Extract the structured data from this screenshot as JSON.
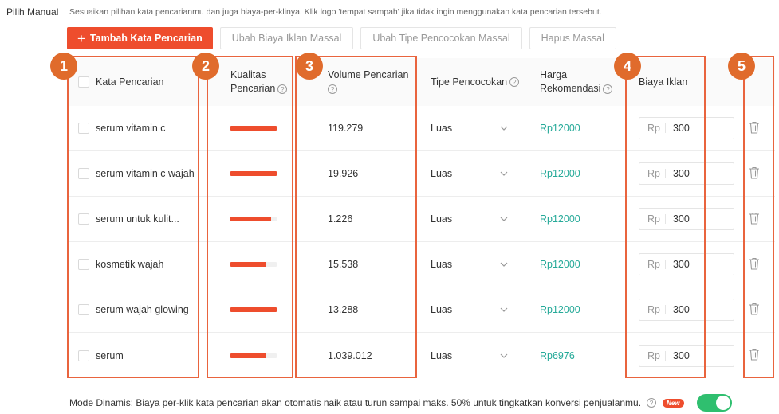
{
  "header": {
    "title": "Pilih Manual",
    "description": "Sesuaikan pilihan kata pencarianmu dan juga biaya-per-klinya. Klik logo 'tempat sampah' jika tidak ingin menggunakan kata pencarian tersebut."
  },
  "toolbar": {
    "add_label": "Tambah Kata Pencarian",
    "edit_bid_label": "Ubah Biaya Iklan Massal",
    "edit_match_label": "Ubah Tipe Pencocokan Massal",
    "delete_label": "Hapus Massal"
  },
  "table": {
    "headers": {
      "keyword": "Kata Pencarian",
      "quality_1": "Kualitas",
      "quality_2": "Pencarian",
      "volume": "Volume Pencarian",
      "match": "Tipe Pencocokan",
      "price_1": "Harga",
      "price_2": "Rekomendasi",
      "bid": "Biaya Iklan",
      "help_glyph": "?"
    },
    "currency_prefix": "Rp",
    "rows": [
      {
        "keyword": "serum vitamin c",
        "quality": 1.0,
        "volume": "119.279",
        "match": "Luas",
        "price": "Rp12000",
        "bid": "300"
      },
      {
        "keyword": "serum vitamin c wajah",
        "quality": 1.0,
        "volume": "19.926",
        "match": "Luas",
        "price": "Rp12000",
        "bid": "300"
      },
      {
        "keyword": "serum untuk kulit...",
        "quality": 0.88,
        "volume": "1.226",
        "match": "Luas",
        "price": "Rp12000",
        "bid": "300"
      },
      {
        "keyword": "kosmetik wajah",
        "quality": 0.78,
        "volume": "15.538",
        "match": "Luas",
        "price": "Rp12000",
        "bid": "300"
      },
      {
        "keyword": "serum wajah glowing",
        "quality": 1.0,
        "volume": "13.288",
        "match": "Luas",
        "price": "Rp12000",
        "bid": "300"
      },
      {
        "keyword": "serum",
        "quality": 0.78,
        "volume": "1.039.012",
        "match": "Luas",
        "price": "Rp6976",
        "bid": "300"
      }
    ]
  },
  "annotations": [
    "1",
    "2",
    "3",
    "4",
    "5"
  ],
  "footer": {
    "text": "Mode Dinamis: Biaya per-klik kata pencarian akan otomatis naik atau turun sampai maks. 50% untuk tingkatkan konversi penjualanmu.",
    "badge": "New",
    "toggle_on": true
  },
  "colors": {
    "accent": "#ee4d2d",
    "price": "#26aa99",
    "marker": "#e06b2c",
    "toggle": "#2fbf6f"
  }
}
